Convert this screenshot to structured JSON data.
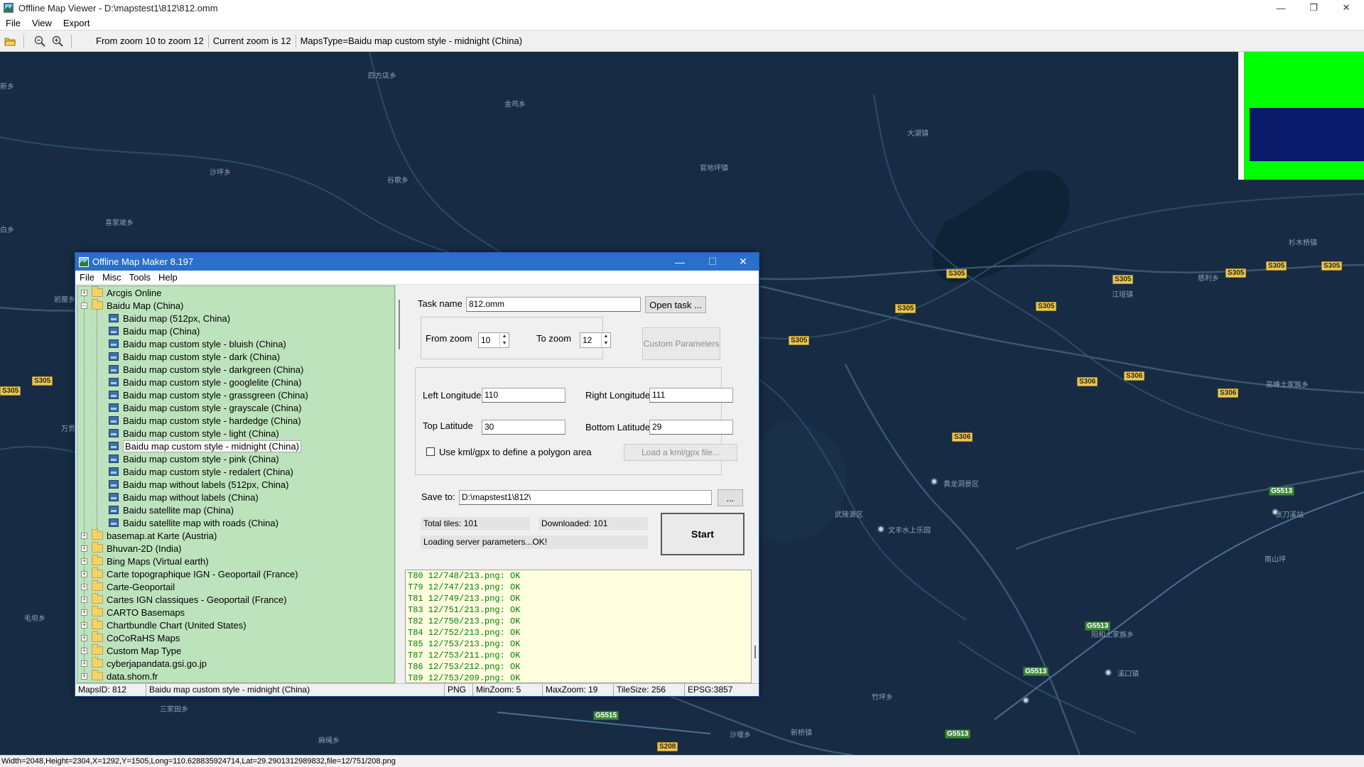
{
  "window": {
    "title": "Offline Map Viewer - D:\\mapstest1\\812\\812.omm",
    "minimize": "—",
    "maximize": "❐",
    "close": "✕"
  },
  "menu": [
    "File",
    "View",
    "Export"
  ],
  "toolbar": {
    "zoom_range": "From zoom 10 to zoom 12",
    "current_zoom": "Current zoom is 12",
    "maps_type": "MapsType=Baidu map custom style - midnight (China)"
  },
  "map": {
    "places": [
      "四方店乡",
      "金鸡乡",
      "大湖镇",
      "沙坪乡",
      "谷歌乡",
      "官地坪镇",
      "喜家坡乡",
      "杉木桥镇",
      "江垭镇",
      "高峰土家族乡",
      "慈利乡",
      "武陵源区",
      "文丰水上乐园",
      "黄龙洞景区",
      "阳和土家族乡",
      "溪口镇",
      "三家田乡",
      "新桥镇",
      "沙堰乡",
      "竹坪乡",
      "麻绳乡",
      "毛坝乡",
      "南山坪",
      "张刀溪站",
      "岩屋乡",
      "万贯乡",
      "白乡",
      "新乡"
    ],
    "roads": [
      "S305",
      "S305",
      "S305",
      "S305",
      "S305",
      "S305",
      "S305",
      "S305",
      "S306",
      "S306",
      "S306",
      "S306",
      "S305",
      "S305",
      "G5513",
      "G5513",
      "G5513",
      "G5515",
      "G5513",
      "S208"
    ],
    "colors": {
      "background": "#172c44",
      "water": "#0f2236",
      "river": "#2a4b6a",
      "road": "#3c5670"
    }
  },
  "statusbar": "Width=2048,Height=2304,X=1292,Y=1505,Long=110.628835924714,Lat=29.2901312989832,file=12/751/208.png",
  "dialog": {
    "title": "Offline Map Maker 8.197",
    "menu": [
      "File",
      "Misc",
      "Tools",
      "Help"
    ],
    "tree": {
      "top": [
        {
          "label": "Arcgis Online",
          "expanded": false
        },
        {
          "label": "Baidu Map (China)",
          "expanded": true
        }
      ],
      "children": [
        "Baidu map (512px, China)",
        "Baidu map (China)",
        "Baidu map custom style - bluish (China)",
        "Baidu map custom style - dark (China)",
        "Baidu map custom style - darkgreen (China)",
        "Baidu map custom style - googlelite (China)",
        "Baidu map custom style - grassgreen (China)",
        "Baidu map custom style - grayscale (China)",
        "Baidu map custom style - hardedge (China)",
        "Baidu map custom style - light (China)",
        "Baidu map custom style - midnight (China)",
        "Baidu map custom style - pink (China)",
        "Baidu map custom style - redalert (China)",
        "Baidu map without labels (512px, China)",
        "Baidu map without labels (China)",
        "Baidu satellite map (China)",
        "Baidu satellite map with roads (China)"
      ],
      "selected_index": 10,
      "rest": [
        "basemap.at Karte (Austria)",
        "Bhuvan-2D (India)",
        "Bing Maps (Virtual earth)",
        "Carte topographique IGN - Geoportail (France)",
        "Carte-Geoportail",
        "Cartes IGN classiques - Geoportail (France)",
        "CARTO Basemaps",
        "Chartbundle Chart (United States)",
        "CoCoRaHS Maps",
        "Custom Map Type",
        "cyberjapandata.gsi.go.jp",
        "data.shom.fr"
      ]
    },
    "task": {
      "task_name_label": "Task name",
      "task_name": "812.omm",
      "open_task": "Open task ...",
      "from_zoom_label": "From zoom",
      "from_zoom": "10",
      "to_zoom_label": "To zoom",
      "to_zoom": "12",
      "custom_params": "Custom Parameters",
      "left_lon_label": "Left Longitude",
      "left_lon": "110",
      "right_lon_label": "Right Longitude",
      "right_lon": "111",
      "top_lat_label": "Top Latitude",
      "top_lat": "30",
      "bottom_lat_label": "Bottom Latitude",
      "bottom_lat": "29",
      "kml_label": "Use kml/gpx to define a polygon area",
      "load_kml": "Load a kml/gpx file...",
      "save_to_label": "Save to:",
      "save_to": "D:\\mapstest1\\812\\",
      "browse": "...",
      "total_tiles": "Total tiles: 101",
      "downloaded": "Downloaded: 101",
      "loading": "Loading server parameters...OK!",
      "start": "Start"
    },
    "log": [
      "T80 12/748/213.png: OK",
      "T79 12/747/213.png: OK",
      "T81 12/749/213.png: OK",
      "T83 12/751/213.png: OK",
      "T82 12/750/213.png: OK",
      "T84 12/752/213.png: OK",
      "T85 12/753/213.png: OK",
      "T87 12/753/211.png: OK",
      "T86 12/753/212.png: OK",
      "T89 12/753/209.png: OK"
    ],
    "status": {
      "maps_id": "MapsID: 812",
      "name": "Baidu map custom style - midnight (China)",
      "format": "PNG",
      "min_zoom": "MinZoom: 5",
      "max_zoom": "MaxZoom: 19",
      "tile_size": "TileSize: 256",
      "epsg": "EPSG:3857"
    }
  }
}
